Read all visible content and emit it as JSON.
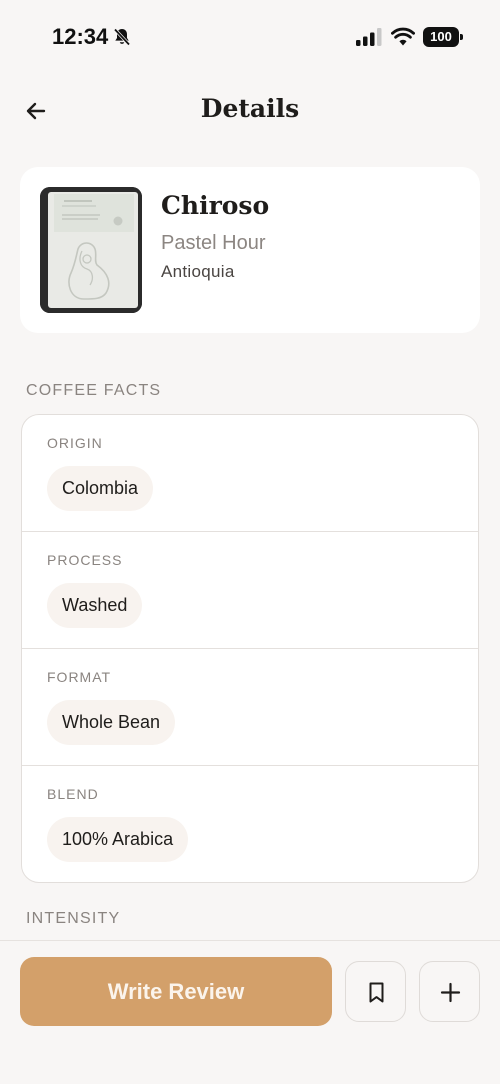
{
  "status_bar": {
    "time": "12:34",
    "battery": "100",
    "icons": [
      "bell-slash-icon",
      "signal-icon",
      "wifi-icon",
      "battery-icon"
    ]
  },
  "header": {
    "title": "Details",
    "back_icon": "arrow-left-icon"
  },
  "product": {
    "name": "Chiroso",
    "roaster": "Pastel Hour",
    "region": "Antioquia",
    "image_icon": "coffee-bag-image"
  },
  "sections": {
    "facts_title": "COFFEE FACTS",
    "intensity_title": "INTENSITY"
  },
  "facts": [
    {
      "label": "ORIGIN",
      "value": "Colombia"
    },
    {
      "label": "PROCESS",
      "value": "Washed"
    },
    {
      "label": "FORMAT",
      "value": "Whole Bean"
    },
    {
      "label": "BLEND",
      "value": "100% Arabica"
    }
  ],
  "bottom_bar": {
    "write_review_label": "Write Review",
    "bookmark_icon": "bookmark-icon",
    "add_icon": "plus-icon"
  },
  "colors": {
    "accent": "#d3a06a",
    "background": "#f8f6f5",
    "chip": "#f8f3ef",
    "muted_text": "#8a8480"
  }
}
